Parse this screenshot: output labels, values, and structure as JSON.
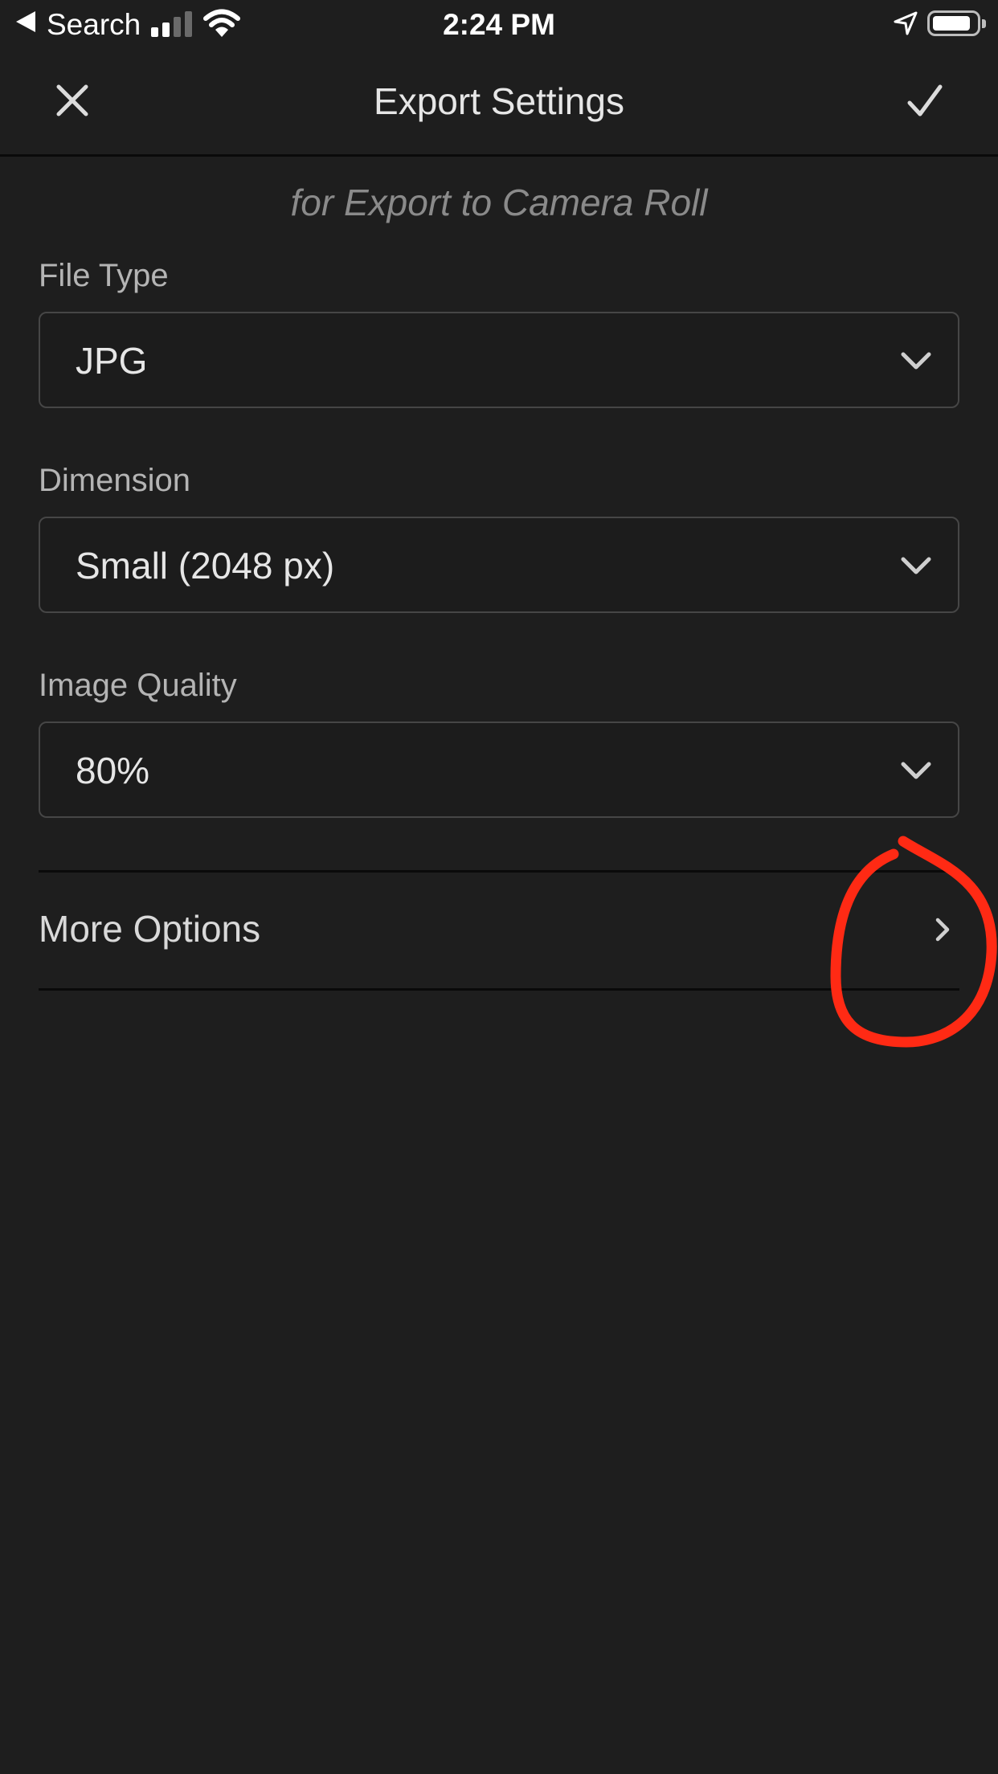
{
  "status_bar": {
    "back_label": "Search",
    "time": "2:24 PM",
    "icons": [
      "back-arrow-icon",
      "signal-icon",
      "wifi-icon",
      "location-icon",
      "battery-icon"
    ]
  },
  "navbar": {
    "title": "Export Settings",
    "close_icon": "close-icon",
    "confirm_icon": "checkmark-icon"
  },
  "subtitle": "for Export to Camera Roll",
  "fields": [
    {
      "label": "File Type",
      "value": "JPG"
    },
    {
      "label": "Dimension",
      "value": "Small (2048 px)"
    },
    {
      "label": "Image Quality",
      "value": "80%"
    }
  ],
  "more_options": {
    "label": "More Options",
    "icon": "chevron-right-icon"
  },
  "annotation": {
    "shape": "hand-drawn circle",
    "color": "#ff2a14"
  },
  "colors": {
    "background": "#1e1e1e",
    "text": "#d9d9d9",
    "muted": "#8a8a8a",
    "border": "#464646",
    "annotation": "#ff2a14"
  }
}
